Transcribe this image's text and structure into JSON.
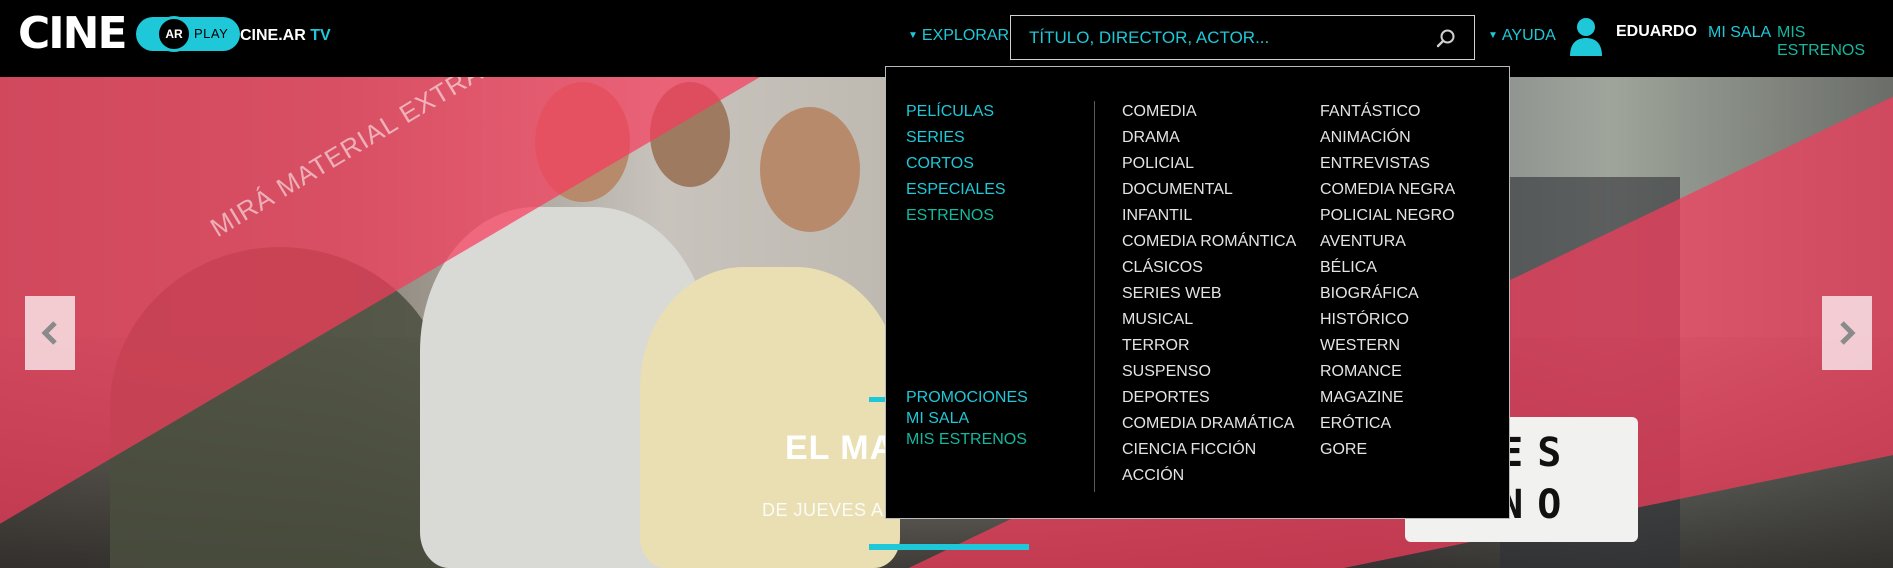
{
  "brand": {
    "logo_text": "CINE",
    "logo_ar": "AR",
    "logo_play": "PLAY",
    "tv_prefix": "CINE.AR",
    "tv_suffix": "TV"
  },
  "nav": {
    "explorar": "EXPLORAR",
    "search_placeholder": "TÍTULO, DIRECTOR, ACTOR...",
    "ayuda": "AYUDA",
    "user": "EDUARDO",
    "mi_sala": "MI SALA",
    "mis_estrenos": "MIS ESTRENOS"
  },
  "dropdown": {
    "main": [
      "PELÍCULAS",
      "SERIES",
      "CORTOS",
      "ESPECIALES",
      "ESTRENOS"
    ],
    "extra": [
      "PROMOCIONES",
      "MI SALA",
      "MIS ESTRENOS"
    ],
    "genres_col1": [
      "COMEDIA",
      "DRAMA",
      "POLICIAL",
      "DOCUMENTAL",
      "INFANTIL",
      "COMEDIA ROMÁNTICA",
      "CLÁSICOS",
      "SERIES WEB",
      "MUSICAL",
      "TERROR",
      "SUSPENSO",
      "DEPORTES",
      "COMEDIA DRAMÁTICA",
      "CIENCIA FICCIÓN",
      "ACCIÓN"
    ],
    "genres_col2": [
      "FANTÁSTICO",
      "ANIMACIÓN",
      "ENTREVISTAS",
      "COMEDIA NEGRA",
      "POLICIAL NEGRO",
      "AVENTURA",
      "BÉLICA",
      "BIOGRÁFICA",
      "HISTÓRICO",
      "WESTERN",
      "ROMANCE",
      "MAGAZINE",
      "ERÓTICA",
      "GORE"
    ]
  },
  "hero": {
    "badge": "MIRÁ MATERIAL EXTRA",
    "title": "EL MA",
    "subtitle": "DE JUEVES A",
    "sign_line1": "EVES",
    "sign_line2": "RENO"
  },
  "colors": {
    "accent": "#1ec8d8",
    "accent_secondary": "#13b89f",
    "pink_overlay": "#f63c5c"
  },
  "icons": {
    "search": "search-icon",
    "user": "user-icon",
    "prev": "chevron-left-icon",
    "next": "chevron-right-icon"
  }
}
